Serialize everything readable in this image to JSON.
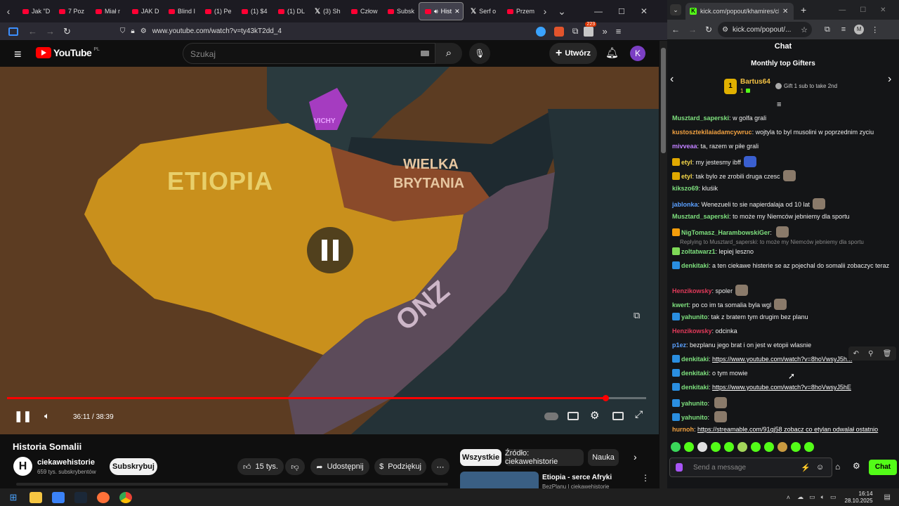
{
  "firefox": {
    "tabs": [
      "Jak \"D",
      "7 Poz",
      "Miał r",
      "JAK D",
      "Blind I",
      "(1) Pe",
      "(1) $4",
      "(1) DL",
      "(3) Sh",
      "Człow",
      "Subsk",
      "Hist",
      "Serf o",
      "Przem"
    ],
    "url": "www.youtube.com/watch?v=ty43kT2dd_4",
    "ext_count": "223"
  },
  "youtube": {
    "logo": "YouTube",
    "region": "PL",
    "search_placeholder": "Szukaj",
    "create_label": "Utwórz",
    "avatar": "K",
    "time": "36:11 / 38:39",
    "progress": 0.936,
    "map_labels": {
      "vichy": "VICHY",
      "ethiopia": "ETIOPIA",
      "uk1": "WIELKA",
      "uk2": "BRYTANIA",
      "onz": "ONZ"
    },
    "title": "Historia Somalii",
    "channel": "ciekawehistorie",
    "subs": "659 tys. subskrybentów",
    "subscribe": "Subskrybuj",
    "likes": "15 tys.",
    "share": "Udostępnij",
    "thanks": "Podziękuj",
    "chips": [
      "Wszystkie",
      "Źródło: ciekawehistorie",
      "Nauka"
    ],
    "rec_title": "Etiopia - serce Afryki",
    "rec_sub": "BezPlanu | ciekawehistorie"
  },
  "chrome": {
    "tab_title": "kick.com/popout/khamires/cha",
    "url": "kick.com/popout/...",
    "avatar": "M"
  },
  "chat": {
    "title": "Chat",
    "gifters_title": "Monthly top Gifters",
    "top_gifter": "Bartus64",
    "rank": "1",
    "gift_count": "1",
    "gift_hint": "Gift 1 sub to take 2nd",
    "messages": [
      {
        "user": "Musztard_saperski",
        "color": "#7ee07e",
        "text": "w golfa grali"
      },
      {
        "user": "kustosztekilaiadamcywruc",
        "color": "#f0a040",
        "text": "wojtyla to byl musolini w poprzednim zyciu"
      },
      {
        "user": "mivveaa",
        "color": "#c080ff",
        "text": "ta, razem w piłe grali"
      },
      {
        "user": "etyl",
        "color": "#f6d84a",
        "text": "my jestesmy ibff"
      },
      {
        "user": "etyl",
        "color": "#f6d84a",
        "text": "tak       bylo ze zrobili druga czesc"
      },
      {
        "user": "kikszo69",
        "color": "#7ee07e",
        "text": "kluśik"
      },
      {
        "user": "jablonka",
        "color": "#5aa0ff",
        "text": "Wenezueli to sie napierdalaja od 10 lat"
      },
      {
        "user": "Musztard_saperski",
        "color": "#7ee07e",
        "text": "to może my Niemców jebniemy dla sportu"
      },
      {
        "user": "NigTomasz_HarambowskiGer",
        "color": "#7ee07e",
        "text": ""
      },
      {
        "user": "zoltatwarz1",
        "color": "#7ee07e",
        "text": "lepiej leszno"
      },
      {
        "user": "denkitaki",
        "color": "#7ee07e",
        "text": "a ten ciekawe histerie se az pojechal do somalii zobaczyc teraz"
      },
      {
        "user": "Henzikowsky",
        "color": "#e23a5a",
        "text": "spoler"
      },
      {
        "user": "kwert",
        "color": "#7ee07e",
        "text": "po co im ta somalia byla wgl"
      },
      {
        "user": "yahunito",
        "color": "#7ee07e",
        "text": "tak z bratem tym drugim bez planu"
      },
      {
        "user": "Henzikowsky",
        "color": "#e23a5a",
        "text": "odcinka"
      },
      {
        "user": "p1ez",
        "color": "#5aa0ff",
        "text": "bezplanu jego brat i on jest w etopii wlasnie"
      },
      {
        "user": "denkitaki",
        "color": "#7ee07e",
        "text": "https://www.youtube.com/watch?v=8hoVwsyJ5h..."
      },
      {
        "user": "denkitaki",
        "color": "#7ee07e",
        "text": "o tym mowie"
      },
      {
        "user": "denkitaki",
        "color": "#7ee07e",
        "text": "https://www.youtube.com/watch?v=8hoVwsyJ5hE"
      },
      {
        "user": "yahunito",
        "color": "#7ee07e",
        "text": ""
      },
      {
        "user": "yahunito",
        "color": "#7ee07e",
        "text": ""
      },
      {
        "user": "hurnoh",
        "color": "#f0a040",
        "text": "https://streamable.com/91qj58 zobacz co etylan odwalał ostatnio"
      }
    ],
    "reply_note": "Replying to Musztard_saperski: to może my Niemców jebniemy dla sportu",
    "input_placeholder": "Send a message",
    "send_label": "Chat"
  },
  "taskbar": {
    "time": "16:14",
    "date": "28.10.2025"
  }
}
